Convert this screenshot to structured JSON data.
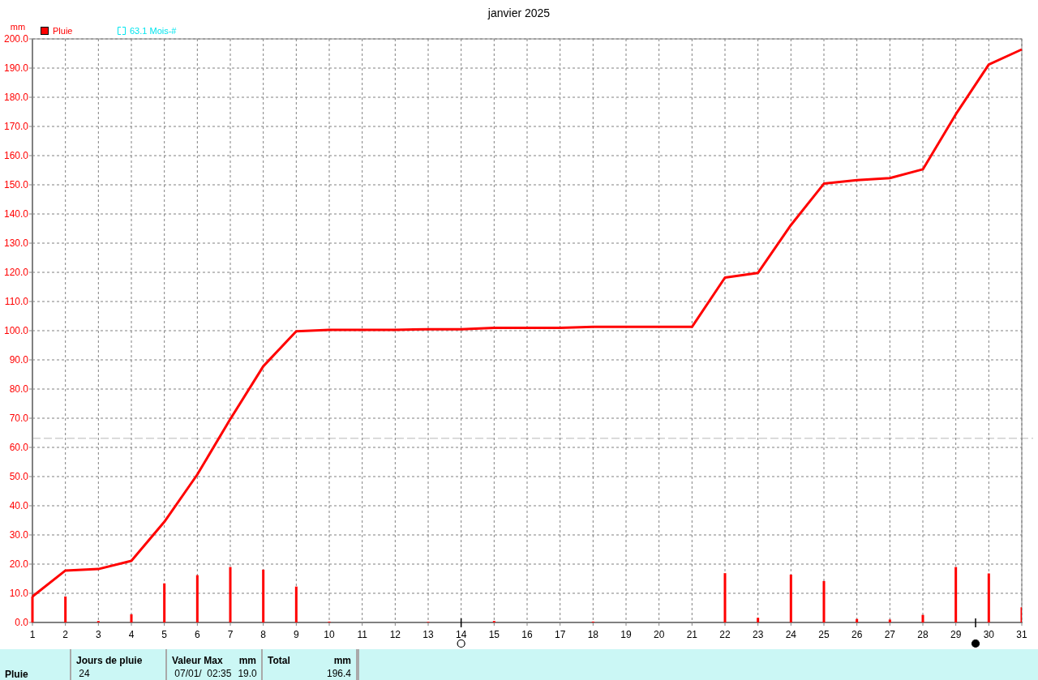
{
  "chart": {
    "title": "janvier 2025",
    "chart_data": {
      "type": "line",
      "ylabel": "mm",
      "x": [
        1,
        2,
        3,
        4,
        5,
        6,
        7,
        8,
        9,
        10,
        11,
        12,
        13,
        14,
        15,
        16,
        17,
        18,
        19,
        20,
        21,
        22,
        23,
        24,
        25,
        26,
        27,
        28,
        29,
        30,
        31
      ],
      "series": [
        {
          "name": "Pluie",
          "color": "#ff0000",
          "values": [
            8.9,
            17.8,
            18.3,
            21.1,
            34.5,
            50.7,
            69.7,
            87.8,
            99.8,
            100.3,
            100.3,
            100.3,
            100.5,
            100.5,
            101.0,
            101.0,
            101.0,
            101.3,
            101.3,
            101.3,
            101.3,
            118.2,
            119.8,
            136.2,
            150.4,
            151.6,
            152.3,
            155.3,
            174.2,
            191.2,
            196.4
          ]
        },
        {
          "type": "bar",
          "color": "#ff0000",
          "values": [
            8.9,
            8.9,
            0.5,
            2.8,
            13.4,
            16.2,
            19.0,
            18.1,
            12.3,
            0.3,
            0,
            0,
            0.2,
            0,
            0.5,
            0,
            0,
            0.3,
            0,
            0,
            0,
            16.9,
            1.6,
            16.4,
            14.2,
            1.2,
            1.0,
            2.6,
            19.0,
            16.8,
            5.2
          ]
        }
      ],
      "xlim": [
        1,
        31
      ],
      "ylim": [
        0,
        200
      ],
      "xticks": [
        1,
        2,
        3,
        4,
        5,
        6,
        7,
        8,
        9,
        10,
        11,
        12,
        13,
        14,
        15,
        16,
        17,
        18,
        19,
        20,
        21,
        22,
        23,
        24,
        25,
        26,
        27,
        28,
        29,
        30,
        31
      ],
      "yticks": [
        {
          "value": 0,
          "label": "0.0"
        },
        {
          "value": 10,
          "label": "10.0"
        },
        {
          "value": 20,
          "label": "20.0"
        },
        {
          "value": 30,
          "label": "30.0"
        },
        {
          "value": 40,
          "label": "40.0"
        },
        {
          "value": 50,
          "label": "50.0"
        },
        {
          "value": 60,
          "label": "60.0"
        },
        {
          "value": 70,
          "label": "70.0"
        },
        {
          "value": 80,
          "label": "80.0"
        },
        {
          "value": 90,
          "label": "90.0"
        },
        {
          "value": 100,
          "label": "100.0"
        },
        {
          "value": 110,
          "label": "110.0"
        },
        {
          "value": 120,
          "label": "120.0"
        },
        {
          "value": 130,
          "label": "130.0"
        },
        {
          "value": 140,
          "label": "140.0"
        },
        {
          "value": 150,
          "label": "150.0"
        },
        {
          "value": 160,
          "label": "160.0"
        },
        {
          "value": 170,
          "label": "170.0"
        },
        {
          "value": 180,
          "label": "180.0"
        },
        {
          "value": 190,
          "label": "190.0"
        },
        {
          "value": 200,
          "label": "200.0"
        }
      ],
      "grid": true,
      "ref_lines": [
        {
          "axis": "y",
          "value": 63.1,
          "color": "#b8b8b8"
        }
      ]
    },
    "legend": [
      {
        "label": "63.1 Mois-#",
        "color": "#00e5ee",
        "kind": "bracket"
      }
    ],
    "moon_phases": [
      {
        "kind": "full"
      },
      {
        "kind": "new"
      }
    ]
  },
  "summary": {
    "row_label": "Pluie",
    "columns": [
      {
        "heading": "Jours de pluie",
        "value": "24"
      },
      {
        "heading": "Valeur Max",
        "unit": "mm",
        "value": "07/01/  02:35",
        "extra": "19.0"
      },
      {
        "heading": "Total",
        "unit": "mm",
        "extra": "196.4"
      }
    ]
  }
}
